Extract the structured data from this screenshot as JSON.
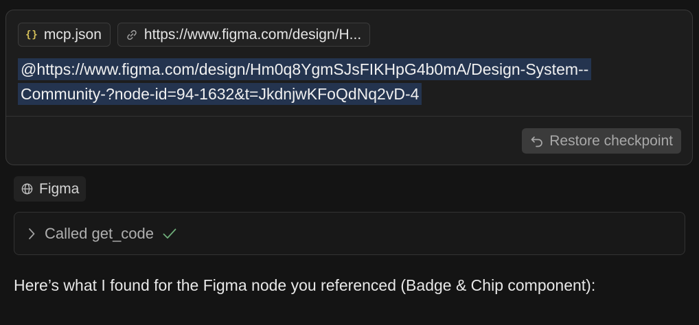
{
  "message": {
    "attachments": [
      {
        "icon": "json-braces-icon",
        "label": "mcp.json"
      },
      {
        "icon": "link-icon",
        "label": "https://www.figma.com/design/H..."
      }
    ],
    "prompt_line1": "@https://www.figma.com/design/Hm0q8YgmSJsFIKHpG4b0mA/Design-System--",
    "prompt_line2": "Community-?node-id=94-1632&t=JkdnjwKFoQdNq2vD-4",
    "restore_label": "Restore checkpoint"
  },
  "context_badge": {
    "icon": "globe-icon",
    "label": "Figma"
  },
  "tool_call": {
    "label": "Called get_code",
    "status": "success"
  },
  "response": {
    "text": "Here’s what I found for the Figma node you referenced (Badge & Chip component):"
  },
  "colors": {
    "background": "#141414",
    "card": "#1d1d1d",
    "highlight": "#24344f",
    "json_brace": "#d7c25a",
    "check": "#6fae7a"
  }
}
